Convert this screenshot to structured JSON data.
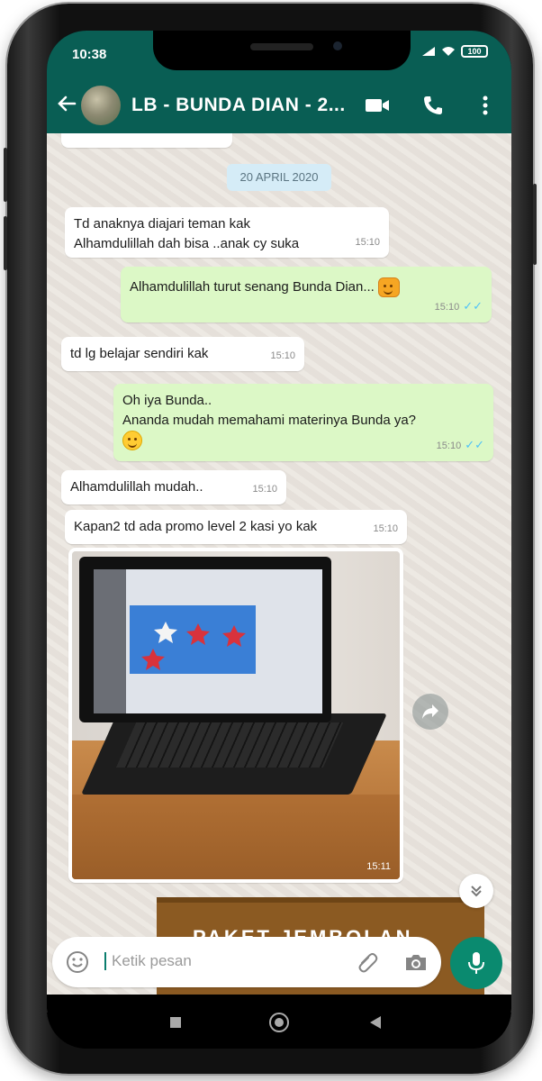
{
  "status_bar": {
    "time": "10:38",
    "battery": "100"
  },
  "header": {
    "title": "LB - BUNDA DIAN - 2..."
  },
  "chat": {
    "date_chip": "20 APRIL 2020",
    "messages": [
      {
        "direction": "in",
        "text_lines": [
          "Td anaknya diajari teman kak",
          "Alhamdulillah dah bisa ..anak cy suka"
        ],
        "time": "15:10"
      },
      {
        "direction": "out",
        "text_lines": [
          "Alhamdulillah turut senang Bunda Dian..."
        ],
        "emoji": "grin",
        "time": "15:10",
        "status": "read"
      },
      {
        "direction": "in",
        "text_lines": [
          "td lg belajar sendiri kak"
        ],
        "time": "15:10"
      },
      {
        "direction": "out",
        "text_lines": [
          "Oh iya Bunda..",
          "Ananda mudah memahami materinya Bunda ya?"
        ],
        "emoji": "smile",
        "time": "15:10",
        "status": "read"
      },
      {
        "direction": "in",
        "text_lines": [
          "Alhamdulillah mudah.."
        ],
        "time": "15:10"
      },
      {
        "direction": "in",
        "text_lines": [
          "Kapan2 td ada promo level 2 kasi yo kak"
        ],
        "time": "15:10"
      },
      {
        "direction": "in",
        "type": "image",
        "time": "15:11"
      }
    ],
    "banner_text": "PAKET JEMBOLAN"
  },
  "composer": {
    "placeholder": "Ketik pesan"
  },
  "icons": {
    "back": "back-arrow-icon",
    "video": "video-call-icon",
    "voice": "phone-call-icon",
    "menu": "more-vert-icon",
    "emoji": "emoji-icon",
    "attach": "paperclip-icon",
    "camera": "camera-icon",
    "mic": "mic-icon",
    "forward": "forward-icon",
    "scroll": "chevron-double-down-icon"
  },
  "colors": {
    "header": "#095e54",
    "incoming": "#ffffff",
    "outgoing": "#dcf8c6",
    "accent": "#0a8a6f",
    "read_ticks": "#4fc3f7"
  }
}
